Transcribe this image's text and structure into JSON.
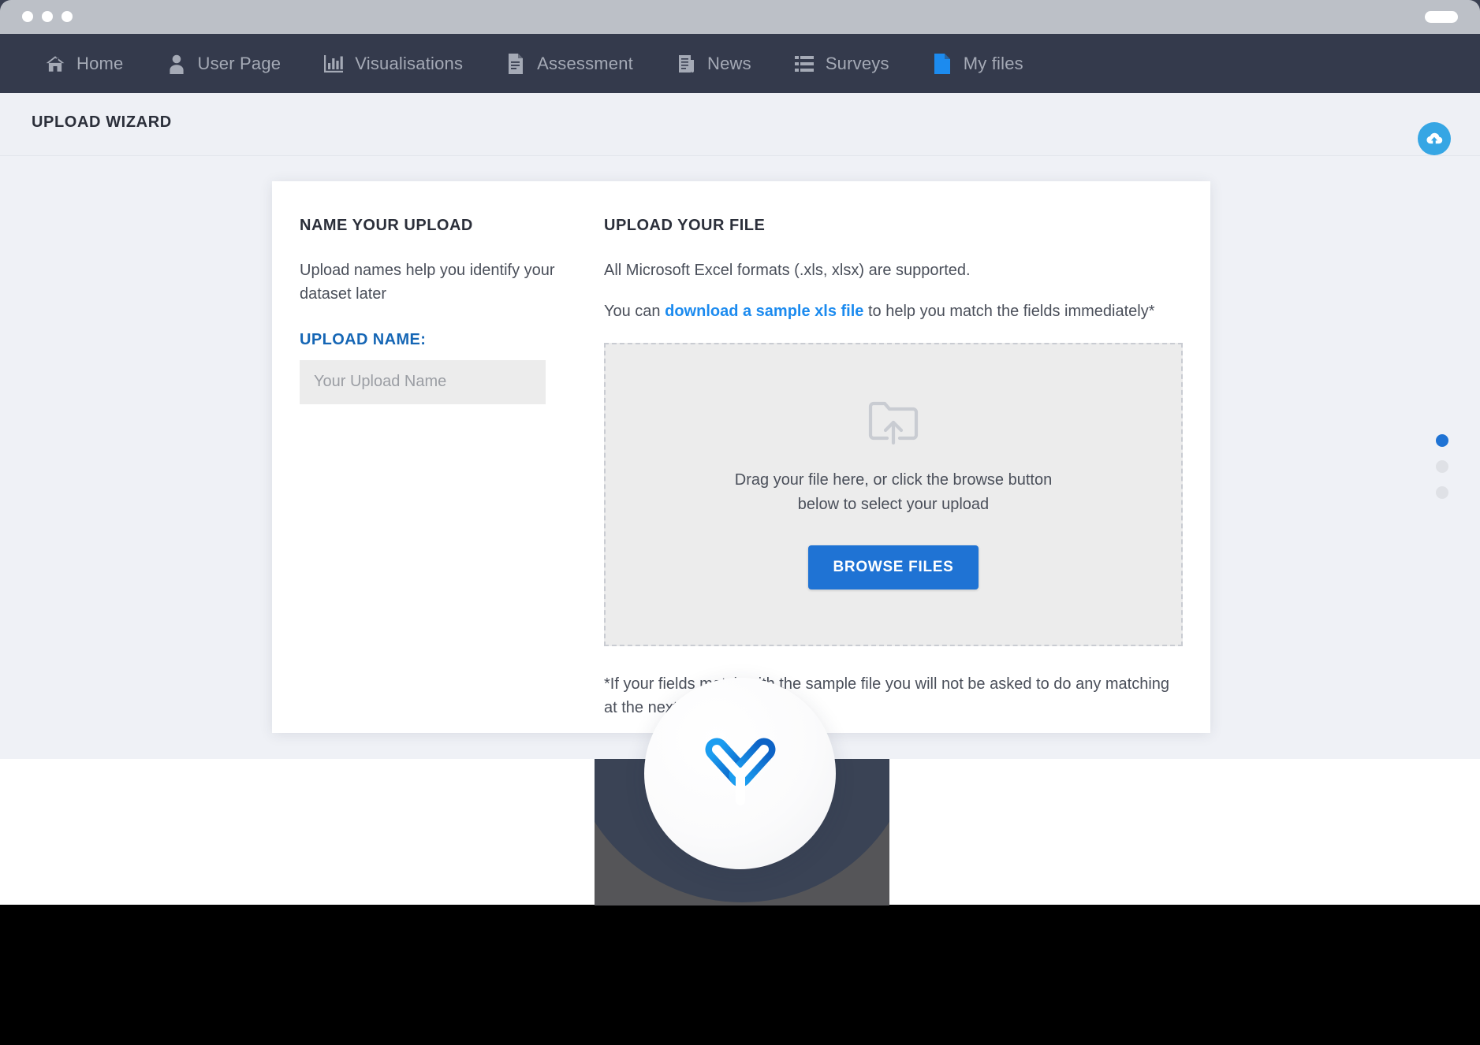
{
  "window": {
    "traffic_lights": [
      "close",
      "minimize",
      "zoom"
    ],
    "right_pill": "menu-pill"
  },
  "navbar": {
    "items": [
      {
        "label": "Home",
        "icon": "home-icon",
        "active": false
      },
      {
        "label": "User Page",
        "icon": "user-icon",
        "active": false
      },
      {
        "label": "Visualisations",
        "icon": "bar-chart-icon",
        "active": false
      },
      {
        "label": "Assessment",
        "icon": "document-lines-icon",
        "active": false
      },
      {
        "label": "News",
        "icon": "newspaper-icon",
        "active": false
      },
      {
        "label": "Surveys",
        "icon": "list-icon",
        "active": false
      },
      {
        "label": "My files",
        "icon": "file-icon",
        "active": true
      }
    ]
  },
  "header": {
    "title": "UPLOAD WIZARD",
    "cloud_button_icon": "cloud-upload-icon"
  },
  "left_panel": {
    "title": "NAME YOUR UPLOAD",
    "description": "Upload names help you identify your dataset later",
    "field_label": "UPLOAD NAME:",
    "field_value": "",
    "field_placeholder": "Your Upload Name"
  },
  "right_panel": {
    "title": "UPLOAD YOUR FILE",
    "formats_text": "All Microsoft Excel formats (.xls, xlsx) are supported.",
    "sample_prefix": "You can ",
    "sample_link": "download a sample xls file",
    "sample_suffix": " to help you match the fields immediately*",
    "dropzone": {
      "icon": "folder-upload-icon",
      "line1": "Drag your file here, or click the browse button",
      "line2": "below to select your upload",
      "button_label": "BROWSE FILES"
    },
    "footnote": "*If your fields match with the sample file you will not be asked to do any matching at the next stage."
  },
  "pager": {
    "dots": [
      {
        "active": true
      },
      {
        "active": false
      },
      {
        "active": false
      }
    ]
  },
  "logo": {
    "name": "y-logo-icon"
  },
  "colors": {
    "navbar_bg": "#343a4c",
    "page_bg": "#eff1f6",
    "accent_blue": "#1f73d4",
    "link_blue": "#1c8bef",
    "label_blue": "#1566b5",
    "cloud_blue": "#36a6e4",
    "titlebar": "#bcc0c7",
    "dropzone_bg": "#ececec"
  }
}
